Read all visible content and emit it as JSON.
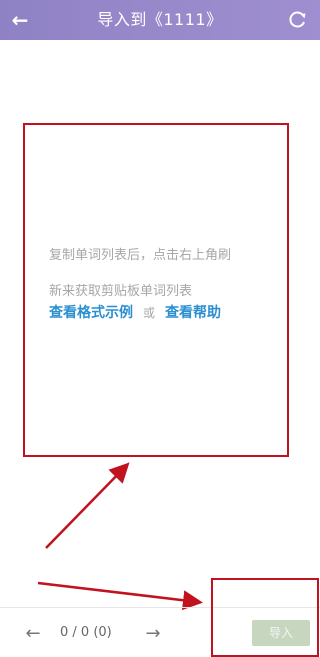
{
  "header": {
    "title": "导入到《1111》",
    "back_icon": "arrow-left-icon",
    "refresh_icon": "refresh-icon"
  },
  "instructions": {
    "line1": "复制单词列表后，点击右上角刷",
    "line2": "新来获取剪贴板单词列表",
    "link_format": "查看格式示例",
    "or_text": "或",
    "link_help": "查看帮助"
  },
  "pager": {
    "prev_icon": "arrow-left-icon",
    "next_icon": "arrow-right-icon",
    "status": "0 / 0  (0)"
  },
  "import_button": {
    "label": "导入"
  },
  "colors": {
    "header_bg": "#9a8bcc",
    "link": "#2a8fd0",
    "annotation": "#c1121f",
    "import_bg": "#c7d6bf"
  }
}
